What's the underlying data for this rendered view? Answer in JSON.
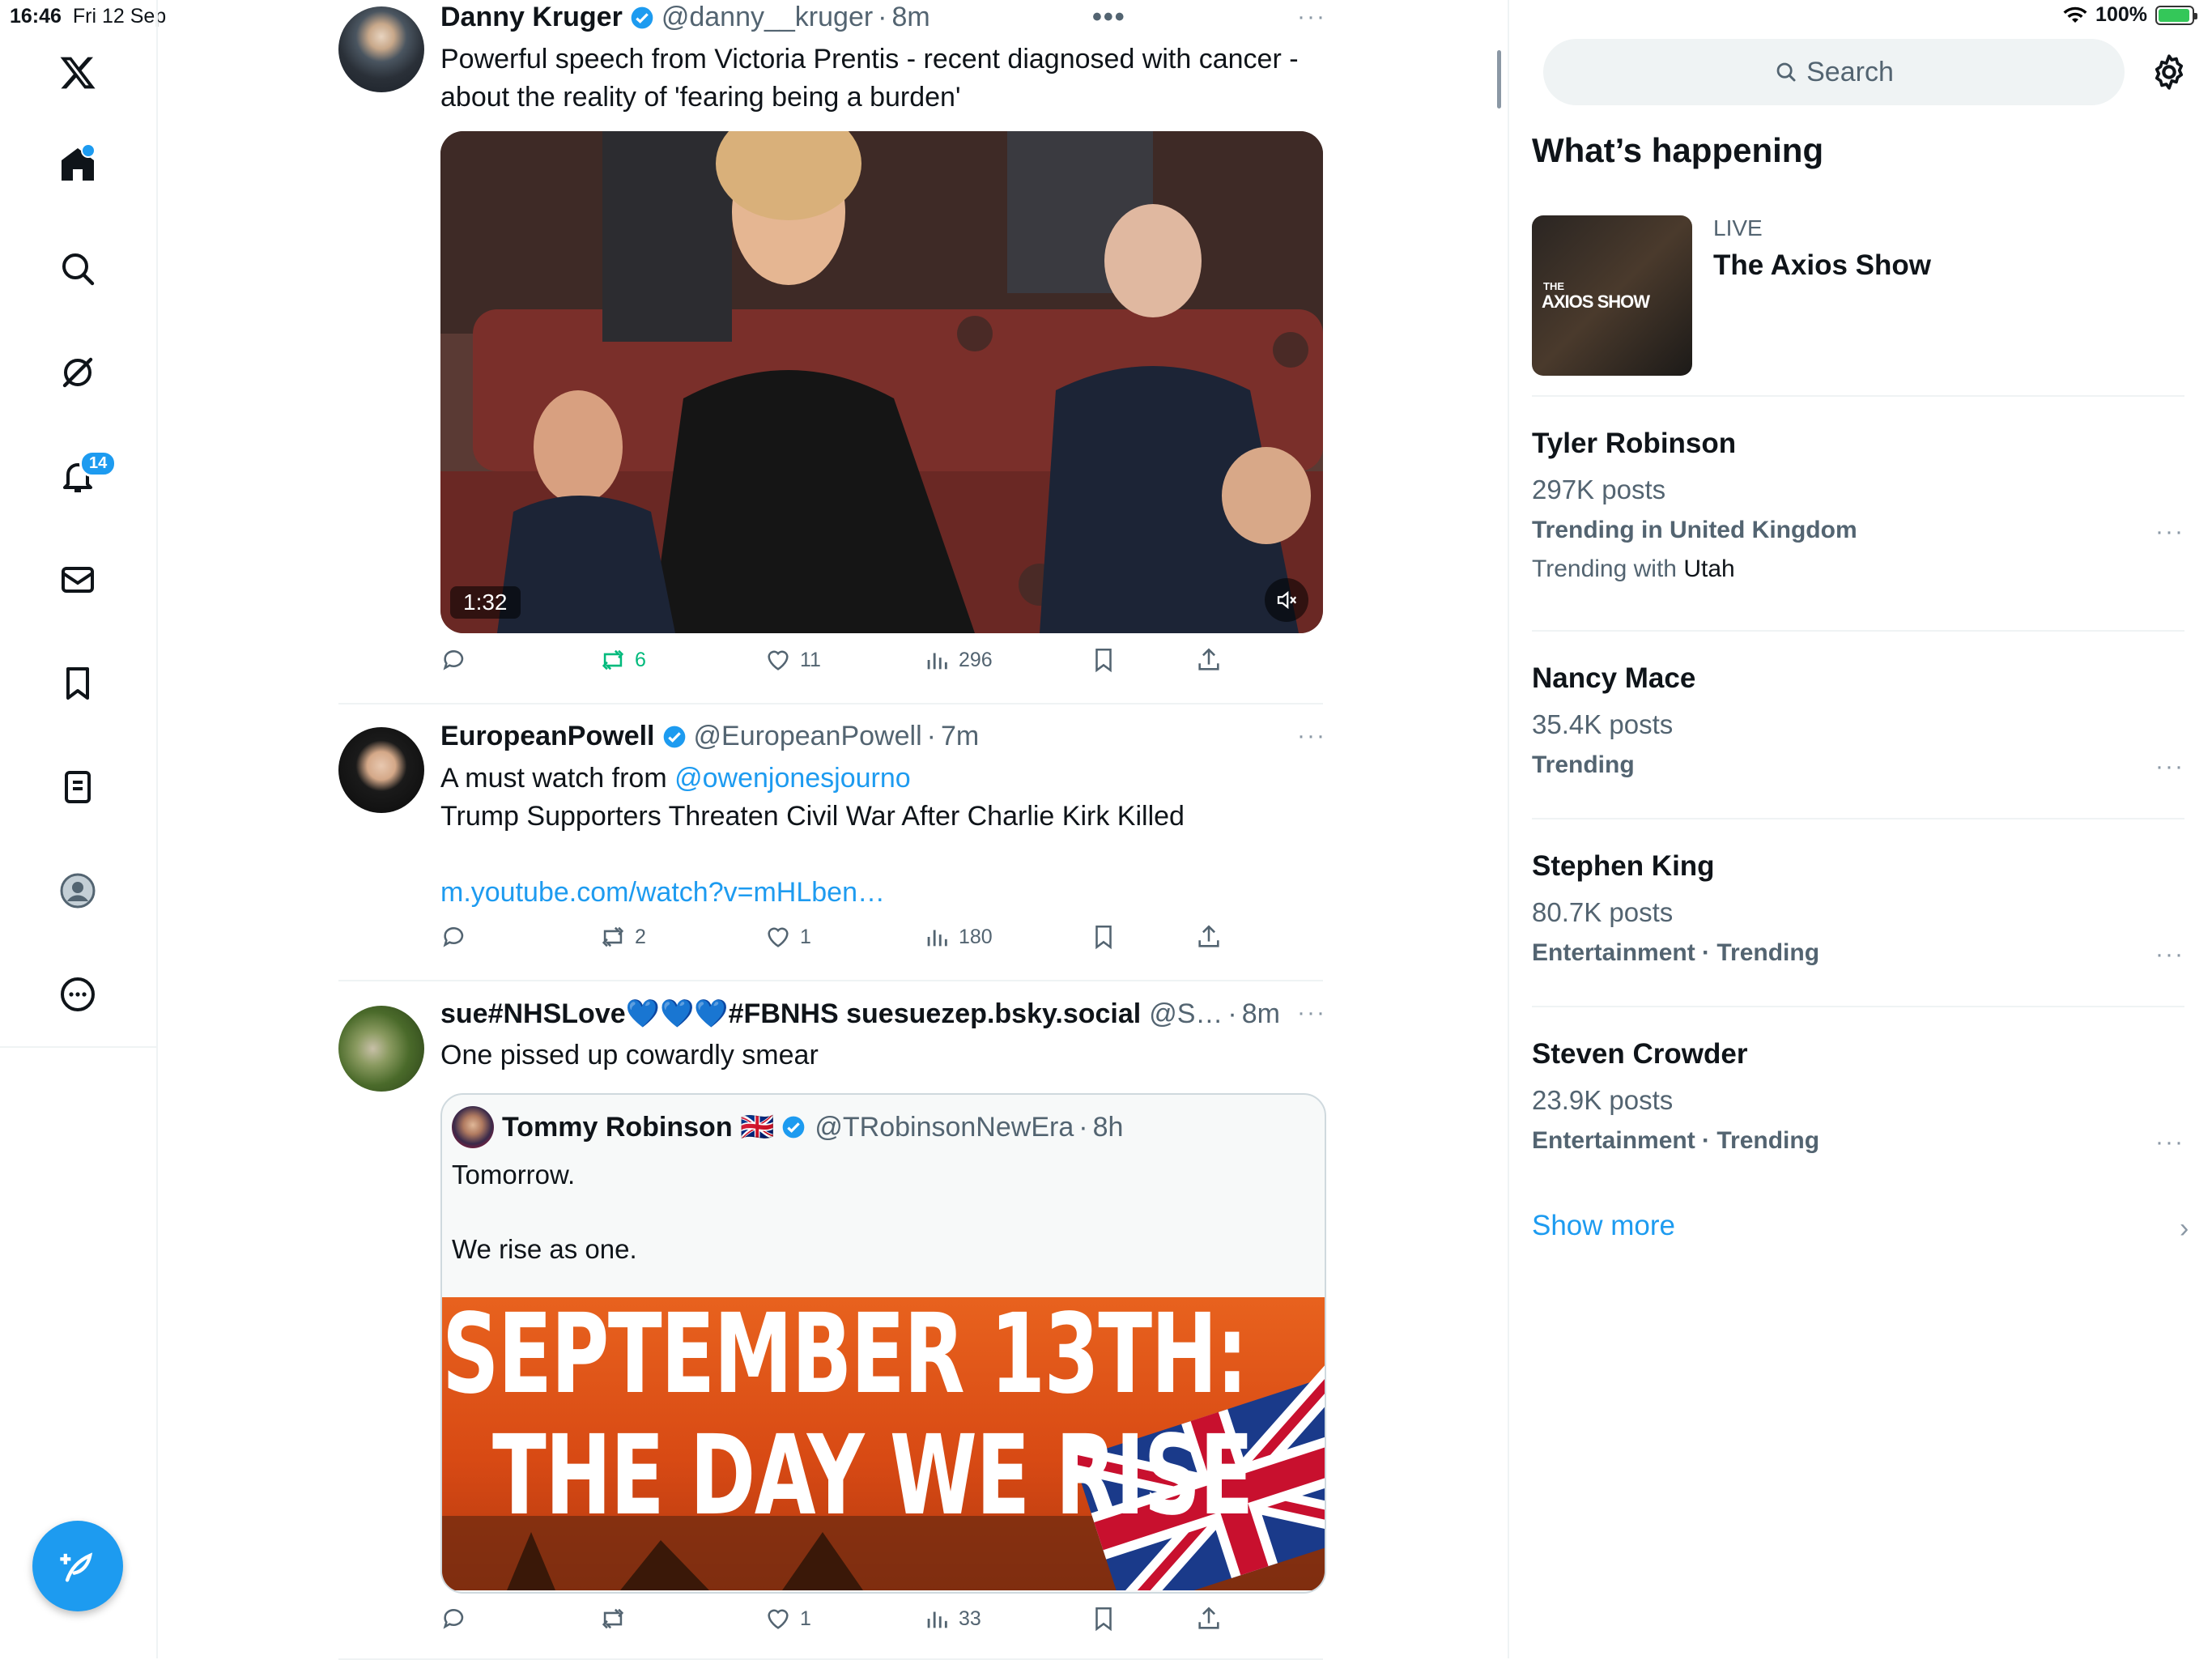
{
  "status_bar": {
    "time": "16:46",
    "date": "Fri 12 Sep",
    "battery": "100%"
  },
  "nav": {
    "notifications_badge": "14"
  },
  "tweets": [
    {
      "name": "Danny Kruger",
      "handle": "@danny__kruger",
      "time": "8m",
      "text": "Powerful speech from Victoria Prentis - recent diagnosed with cancer - about the reality of 'fearing being a burden'",
      "video_duration": "1:32",
      "actions": {
        "replies": "",
        "reposts": "6",
        "likes": "11",
        "views": "296"
      }
    },
    {
      "name": "EuropeanPowell",
      "handle": "@EuropeanPowell",
      "time": "7m",
      "text_prefix": "A must watch from ",
      "mention": "@owenjonesjourno",
      "text_line2": "Trump Supporters Threaten Civil War After Charlie Kirk Killed",
      "link": "m.youtube.com/watch?v=mHLben…",
      "actions": {
        "replies": "",
        "reposts": "2",
        "likes": "1",
        "views": "180"
      }
    },
    {
      "name": "sue#NHSLove💙💙💙#FBNHS suesuezep.bsky.social",
      "handle": "@S…",
      "time": "8m",
      "text": "One pissed up cowardly smear",
      "quote": {
        "name": "Tommy Robinson 🇬🇧",
        "handle": "@TRobinsonNewEra",
        "time": "8h",
        "line1": "Tomorrow.",
        "line2": "We rise as one.",
        "banner_line1": "SEPTEMBER 13TH:",
        "banner_line2": "THE DAY WE RISE"
      },
      "actions": {
        "replies": "",
        "reposts": "",
        "likes": "1",
        "views": "33"
      }
    }
  ],
  "right": {
    "search_placeholder": "Search",
    "section_title": "What’s happening",
    "live": {
      "label": "LIVE",
      "title": "The Axios Show",
      "thumb_text": "AXIOS SHOW",
      "thumb_small": "THE"
    },
    "trends": [
      {
        "name": "Tyler Robinson",
        "count": "297K posts",
        "context": "Trending in United Kingdom",
        "with_label": "Trending with",
        "with_value": "Utah"
      },
      {
        "name": "Nancy Mace",
        "count": "35.4K posts",
        "context": "Trending"
      },
      {
        "name": "Stephen King",
        "count": "80.7K posts",
        "context": "Entertainment · Trending"
      },
      {
        "name": "Steven Crowder",
        "count": "23.9K posts",
        "context": "Entertainment · Trending"
      }
    ],
    "show_more": "Show more"
  },
  "colors": {
    "accent": "#1d9bf0",
    "repost_green": "#00ba7c",
    "muted": "#536471",
    "banner_orange": "#d84a14"
  }
}
